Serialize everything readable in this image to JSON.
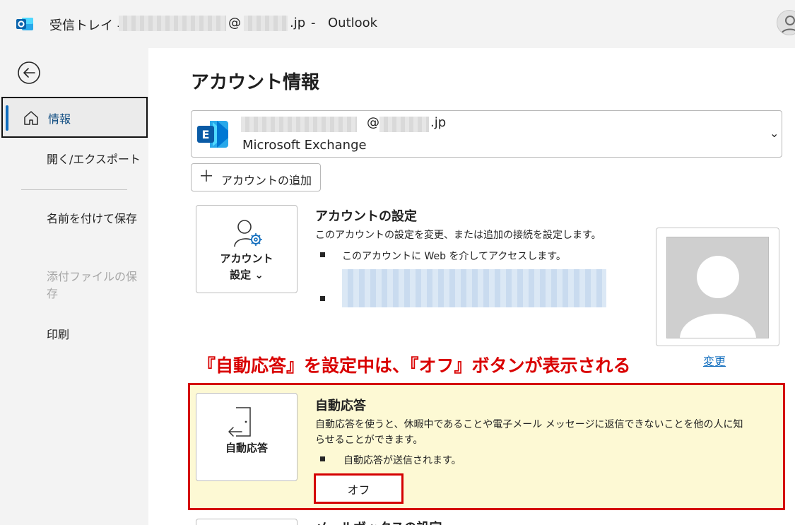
{
  "window": {
    "title_prefix": "受信トレイ -",
    "title_at": "@",
    "title_domain": ".jp",
    "title_separator": "-",
    "app_name": "Outlook"
  },
  "sidebar": {
    "items": [
      {
        "label": "情報",
        "selected": true
      },
      {
        "label": "開く/エクスポート"
      },
      {
        "label": "名前を付けて保存"
      },
      {
        "label": "添付ファイルの保存",
        "disabled": true
      },
      {
        "label": "印刷"
      }
    ]
  },
  "main": {
    "page_title": "アカウント情報",
    "account": {
      "email_at": "@",
      "email_domain": ".jp",
      "type": "Microsoft Exchange",
      "chevron": "⌄"
    },
    "add_account_label": "アカウントの追加",
    "account_settings": {
      "tile_line1": "アカウント",
      "tile_line2": "設定 ⌄",
      "title": "アカウントの設定",
      "description": "このアカウントの設定を変更、または追加の接続を設定します。",
      "bullet1": "このアカウントに Web を介してアクセスします。"
    },
    "change_link": "変更",
    "annotation": "『自動応答』を設定中は、『オフ』ボタンが表示される",
    "auto_reply": {
      "tile_label": "自動応答",
      "title": "自動応答",
      "description_line1": "自動応答を使うと、休暇中であることや電子メール メッセージに返信できないことを他の人に知",
      "description_line2": "らせることができます。",
      "bullet": "自動応答が送信されます。",
      "off_button": "オフ"
    },
    "next_section_title": "メールボックスの設定"
  },
  "colors": {
    "accent": "#0f6cbd",
    "highlight_border": "#d40000",
    "highlight_background": "#fdf9d4",
    "annotation_text": "#d90000"
  }
}
